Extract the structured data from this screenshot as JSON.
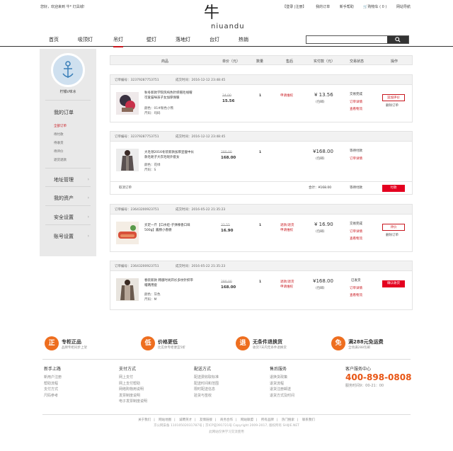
{
  "topbar": {
    "greeting": "您好，欢迎来到 牛* 灯具城!",
    "login": "【登录 |注册】",
    "my_orders": "我的订单",
    "help": "新手帮助",
    "cart": "购物车 ( 0 )",
    "sitemap": "网站导航"
  },
  "logo": {
    "mark": "牛",
    "word": "niuandu"
  },
  "nav": {
    "items": [
      "首页",
      "吸顶灯",
      "吊灯",
      "壁灯",
      "落地灯",
      "台灯",
      "热销"
    ],
    "active_index": 2
  },
  "search": {
    "placeholder": ""
  },
  "sidebar": {
    "username": "柠檬c味冰",
    "my_orders": "我的订单",
    "subs": [
      "全部订单",
      "待付款",
      "待收货",
      "待评价",
      "退货退款"
    ],
    "address": "地址管理",
    "assets": "我的资产",
    "security": "安全设置",
    "account": "账号设置"
  },
  "table_header": {
    "product": "商品",
    "price": "单价（元）",
    "qty": "数量",
    "after_sale": "售后",
    "paid": "实付款（元）",
    "status": "交易状态",
    "action": "操作"
  },
  "orders": [
    {
      "no": "订单编号：32379287753751",
      "time": "成交时间：2016-12-12 23:48:45",
      "name": "秋冬新款学院风纯色针织帽毛线帽可爱猫咪孩子女加厚保暖",
      "color": "颜色：01#粉色小熊",
      "size": "尺码：均码",
      "old_price": "24.00",
      "price": "15.56",
      "qty": "1",
      "after_sale": "申请维权",
      "paid": "¥ 13.56",
      "paid_note": "(包邮)",
      "status": [
        "交易完成",
        "订单详情",
        "查看物流"
      ],
      "action_label": "追加评价",
      "action_extra": "删除订单",
      "action_style": "outline",
      "footer": null
    },
    {
      "no": "订单编号：32379287753751",
      "time": "成交时间：2016-12-12 23:48:45",
      "name": "大毛领2016冬装新款加厚显瘦中长款毛呢子大衣毛呢外套女",
      "color": "颜色：花绿",
      "size": "尺码：S",
      "old_price": "280.00",
      "price": "168.00",
      "qty": "1",
      "after_sale": "",
      "paid": "¥168.00",
      "paid_note": "(包邮)",
      "status": [
        "等待付款",
        "订单详情"
      ],
      "action_label": "",
      "action_extra": "",
      "action_style": "none",
      "footer": {
        "cancel": "取消订单",
        "total": "合计：¥168.00",
        "status": "等待付款",
        "pay": "付款"
      }
    },
    {
      "no": "订单编号：23643200923751",
      "time": "成交时间：2016-05-22 21:35:23",
      "name": "买足一斤【口水娃-子弹辣香口味500g】酱肠小香肠",
      "color": "颜色：",
      "size": "尺码：",
      "old_price": "32.55",
      "price": "16.90",
      "qty": "1",
      "after_sale": "退款/退货\n申请维权",
      "paid": "¥ 16.90",
      "paid_note": "(包邮)",
      "status": [
        "交易完成",
        "订单详情",
        "查看物流"
      ],
      "action_label": "评价",
      "action_extra": "删除订单",
      "action_style": "outline",
      "footer": null
    },
    {
      "no": "订单编号：23643200923751",
      "time": "成交时间：2016-05-22 21:35:23",
      "name": "春装新款 韩版时尚开衫多纹针织带帽两用套",
      "color": "颜色：灰色",
      "size": "尺码：M",
      "old_price": "280.00",
      "price": "168.00",
      "qty": "1",
      "after_sale": "退款/退货\n申请维权",
      "paid": "¥168.00",
      "paid_note": "(包邮)",
      "status": [
        "已发货",
        "订单详情",
        "查看物流"
      ],
      "action_label": "确认收货",
      "action_extra": "",
      "action_style": "solid",
      "footer": null
    }
  ],
  "promos": [
    {
      "icon": "正",
      "title": "专柜正品",
      "sub": "品牌专柜同步上架"
    },
    {
      "icon": "低",
      "title": "价格更低",
      "sub": "比实体专柜便宜5折"
    },
    {
      "icon": "退",
      "title": "无条件退换货",
      "sub": "收货7天内无条件退换货"
    },
    {
      "icon": "免",
      "title": "满288元免运费",
      "sub": "全场满288包邮"
    }
  ],
  "footer_cols": [
    {
      "title": "新手上路",
      "links": [
        "新用户注册",
        "帮助流程",
        "支付方式",
        "尺码参考"
      ]
    },
    {
      "title": "支付方式",
      "links": [
        "网上支付",
        "网上支付帮助",
        "网络购物用说明",
        "发票制度说明",
        "电子发票制度说明"
      ]
    },
    {
      "title": "配送方式",
      "links": [
        "配送费收取标准",
        "配送时间和范围",
        "限时配送信息",
        "验货与签收"
      ]
    },
    {
      "title": "售后服务",
      "links": [
        "退换货政策",
        "退货流程",
        "退货注册邮送",
        "退货方式及时间"
      ]
    }
  ],
  "service": {
    "title": "客户服务中心",
    "phone": "400-898-0808",
    "hours": "服务时间9：00-21：00"
  },
  "footer_links": [
    "关于我们",
    "网站地图",
    "诚聘英才",
    "友情链接",
    "商务合作",
    "网站联盟",
    "所有品牌",
    "热门搜索",
    "联系我们"
  ],
  "copyright": "京公网安备 11010502031787号 | 京ICP证091721号 Copyright 2009-2017, 版权所有 SHIJIE.NET",
  "copyright_note": "此网站仅供学习交流使用",
  "colors": {
    "accent": "#c8161d",
    "promo_orange": "#ee6e1f",
    "phone_orange": "#e85514"
  }
}
